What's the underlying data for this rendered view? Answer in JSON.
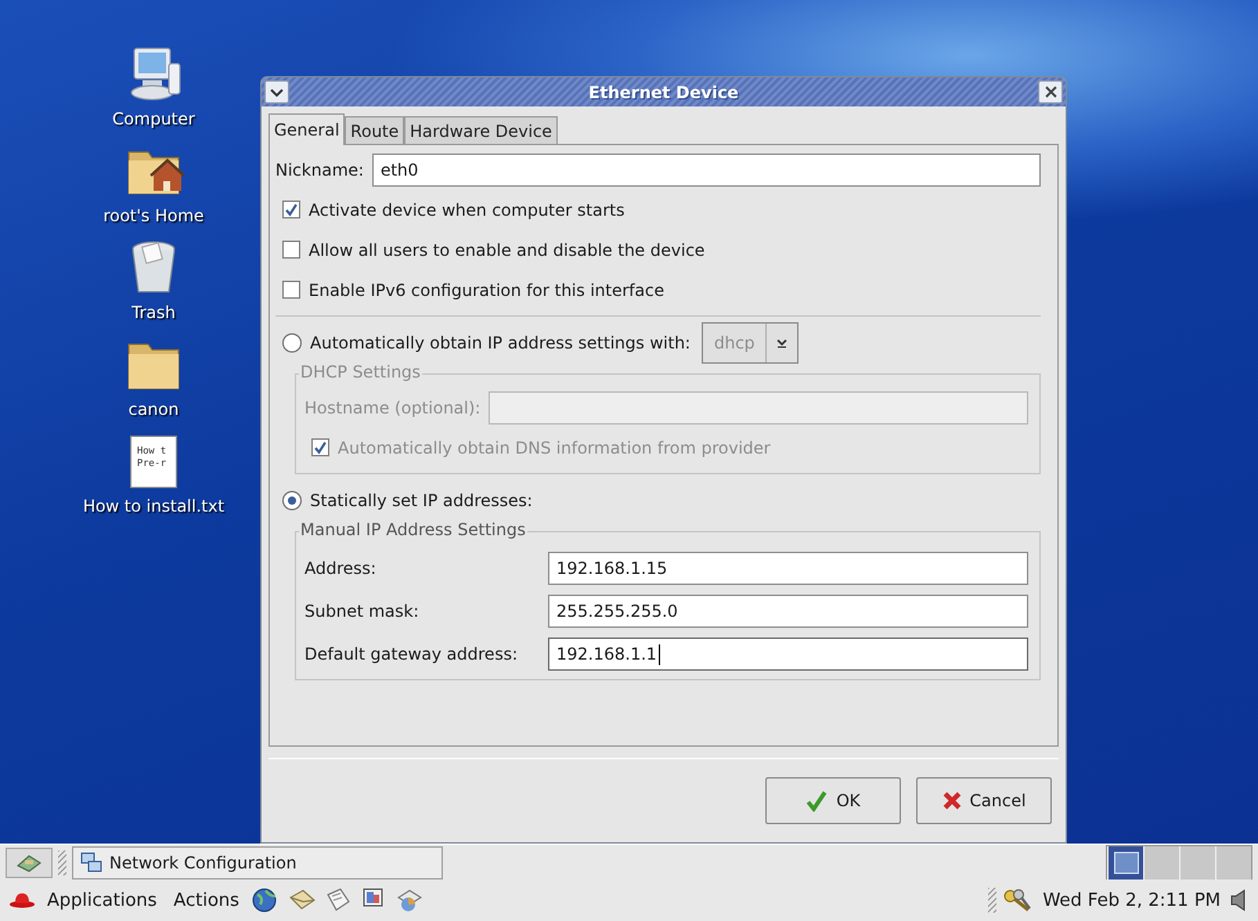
{
  "desktop_icons": [
    {
      "kind": "computer",
      "label": "Computer"
    },
    {
      "kind": "home",
      "label": "root's Home"
    },
    {
      "kind": "trash",
      "label": "Trash"
    },
    {
      "kind": "folder",
      "label": "canon"
    },
    {
      "kind": "textfile",
      "label": "How to install.txt",
      "preview": [
        "How t",
        "Pre-r"
      ]
    }
  ],
  "dialog": {
    "title": "Ethernet Device",
    "tabs": [
      {
        "label": "General",
        "selected": true
      },
      {
        "label": "Route",
        "selected": false
      },
      {
        "label": "Hardware Device",
        "selected": false
      }
    ],
    "nickname": {
      "label": "Nickname:",
      "value": "eth0"
    },
    "checkboxes": [
      {
        "label": "Activate device when computer starts",
        "checked": true
      },
      {
        "label": "Allow all users to enable and disable the device",
        "checked": false
      },
      {
        "label": "Enable IPv6 configuration for this interface",
        "checked": false
      }
    ],
    "auto_ip": {
      "label": "Automatically obtain IP address settings with:",
      "selected": false,
      "method": "dhcp"
    },
    "dhcp_settings": {
      "title": "DHCP Settings",
      "disabled": true,
      "hostname_label": "Hostname (optional):",
      "dns": {
        "label": "Automatically obtain DNS information from provider",
        "checked": true
      }
    },
    "static_ip": {
      "label": "Statically set IP addresses:",
      "selected": true
    },
    "manual_settings": {
      "title": "Manual IP Address Settings",
      "fields": [
        {
          "label": "Address:",
          "value": "192.168.1.15",
          "focused": false
        },
        {
          "label": "Subnet mask:",
          "value": "255.255.255.0",
          "focused": false
        },
        {
          "label": "Default gateway address:",
          "value": "192.168.1.1",
          "focused": true
        }
      ]
    },
    "buttons": [
      {
        "kind": "ok",
        "label": "OK"
      },
      {
        "kind": "cancel",
        "label": "Cancel"
      }
    ]
  },
  "taskbar": {
    "window_button": "Network Configuration",
    "workspaces": [
      {
        "selected": true
      },
      {
        "selected": false
      },
      {
        "selected": false
      },
      {
        "selected": false
      }
    ]
  },
  "panel": {
    "menus": [
      "Applications",
      "Actions"
    ],
    "clock": "Wed Feb 2, 2:11 PM"
  }
}
